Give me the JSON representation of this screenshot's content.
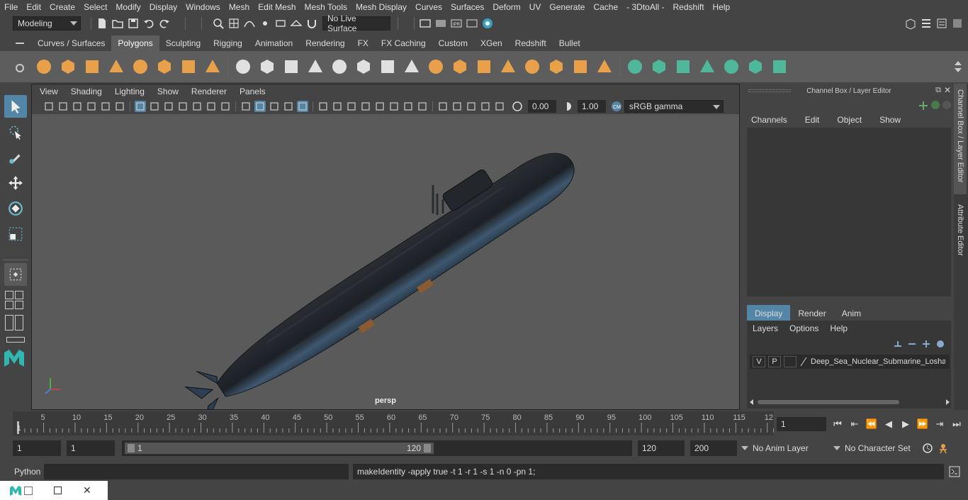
{
  "menu": [
    "File",
    "Edit",
    "Create",
    "Select",
    "Modify",
    "Display",
    "Windows",
    "Mesh",
    "Edit Mesh",
    "Mesh Tools",
    "Mesh Display",
    "Curves",
    "Surfaces",
    "Deform",
    "UV",
    "Generate",
    "Cache",
    "- 3DtoAll -",
    "Redshift",
    "Help"
  ],
  "status": {
    "mode": "Modeling",
    "live_surface": "No Live Surface"
  },
  "shelf_tabs": [
    "Curves / Surfaces",
    "Polygons",
    "Sculpting",
    "Rigging",
    "Animation",
    "Rendering",
    "FX",
    "FX Caching",
    "Custom",
    "XGen",
    "Redshift",
    "Bullet"
  ],
  "shelf_active": "Polygons",
  "viewport": {
    "menu": [
      "View",
      "Shading",
      "Lighting",
      "Show",
      "Renderer",
      "Panels"
    ],
    "exposure": "0.00",
    "gamma": "1.00",
    "color_space": "sRGB gamma",
    "camera_label": "persp"
  },
  "channel_box": {
    "title": "Channel Box / Layer Editor",
    "menu": [
      "Channels",
      "Edit",
      "Object",
      "Show"
    ],
    "side_tabs": [
      "Channel Box / Layer Editor",
      "Attribute Editor"
    ]
  },
  "layer_editor": {
    "tabs": [
      "Display",
      "Render",
      "Anim"
    ],
    "active_tab": "Display",
    "menu": [
      "Layers",
      "Options",
      "Help"
    ],
    "layer": {
      "v": "V",
      "p": "P",
      "name": "Deep_Sea_Nuclear_Submarine_Losha"
    }
  },
  "timeline": {
    "ticks": [
      "5",
      "10",
      "15",
      "20",
      "25",
      "30",
      "35",
      "40",
      "45",
      "50",
      "55",
      "60",
      "65",
      "70",
      "75",
      "80",
      "85",
      "90",
      "95",
      "100",
      "105",
      "110",
      "115",
      "12"
    ],
    "start_label": "1",
    "current_frame": "1"
  },
  "range": {
    "start": "1",
    "playback_start": "1",
    "slider_start": "1",
    "slider_end": "120",
    "playback_end": "120",
    "end": "200",
    "anim_layer": "No Anim Layer",
    "char_set": "No Character Set"
  },
  "command": {
    "lang": "Python",
    "feedback": "makeIdentity -apply true -t 1 -r 1 -s 1 -n 0 -pn 1;"
  },
  "colors": {
    "accent": "#5285a6",
    "orange": "#e8a04a",
    "teal": "#4fb89a"
  }
}
